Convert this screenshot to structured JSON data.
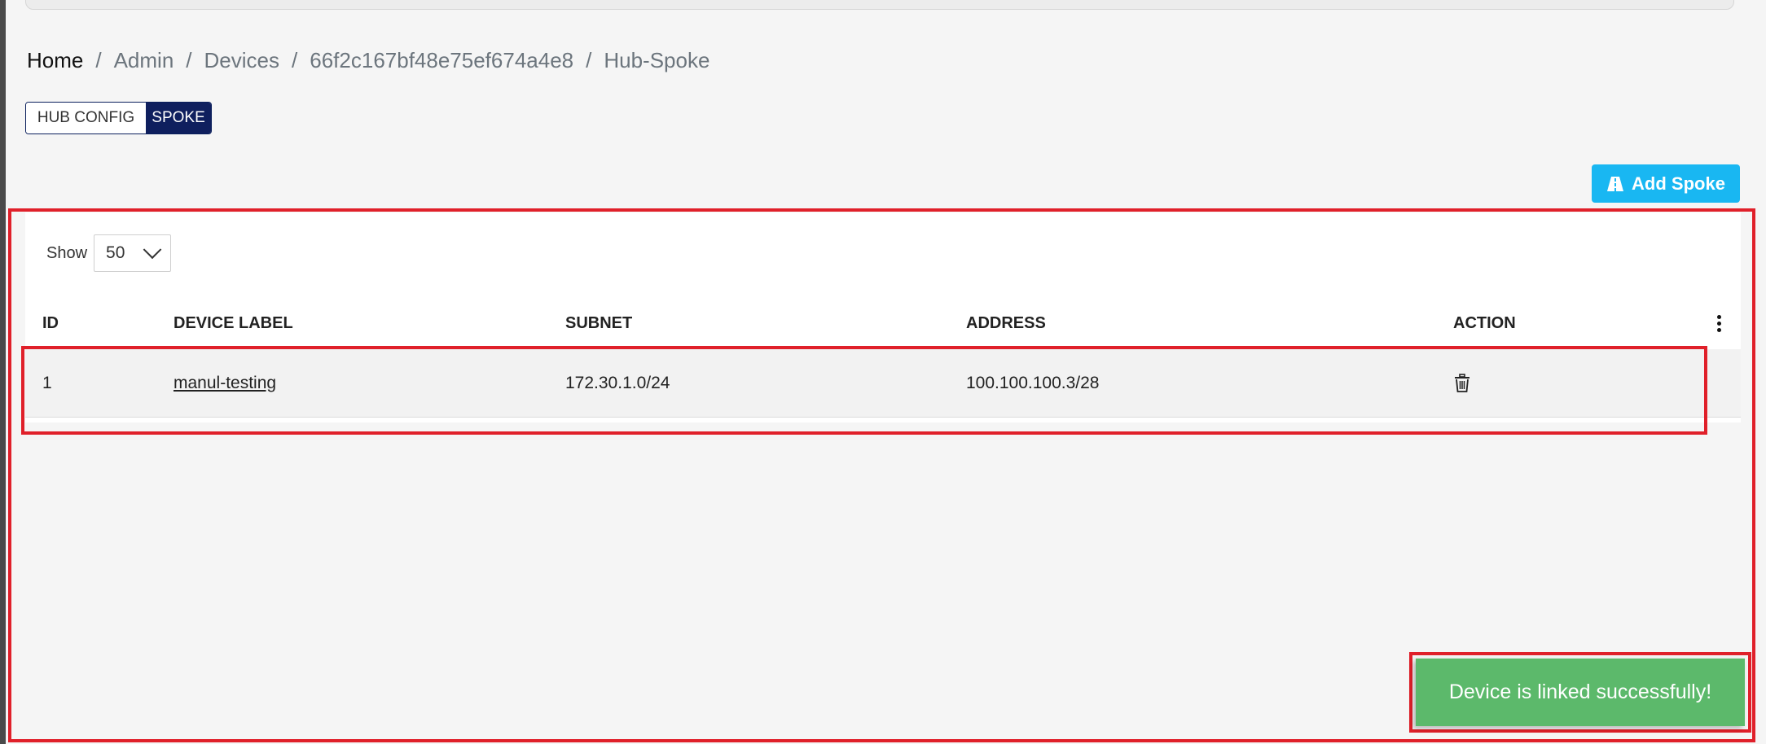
{
  "breadcrumb": {
    "items": [
      "Home",
      "Admin",
      "Devices",
      "66f2c167bf48e75ef674a4e8",
      "Hub-Spoke"
    ],
    "separator": "/"
  },
  "tabs": [
    {
      "label": "HUB CONFIG",
      "active": false
    },
    {
      "label": "SPOKE",
      "active": true
    }
  ],
  "toolbar": {
    "add_spoke_label": "Add Spoke",
    "add_spoke_icon": "road-icon"
  },
  "table_controls": {
    "show_label": "Show",
    "page_size": "50"
  },
  "table": {
    "columns": [
      "ID",
      "DEVICE LABEL",
      "SUBNET",
      "ADDRESS",
      "ACTION"
    ],
    "rows": [
      {
        "id": "1",
        "device_label": "manul-testing",
        "subnet": "172.30.1.0/24",
        "address": "100.100.100.3/28",
        "action_icon": "trash-icon"
      }
    ]
  },
  "toast": {
    "message": "Device is linked successfully!"
  },
  "colors": {
    "primary_dark": "#0f1f5e",
    "accent": "#19b7f2",
    "success": "#5cb96b",
    "highlight": "#e0202a"
  }
}
